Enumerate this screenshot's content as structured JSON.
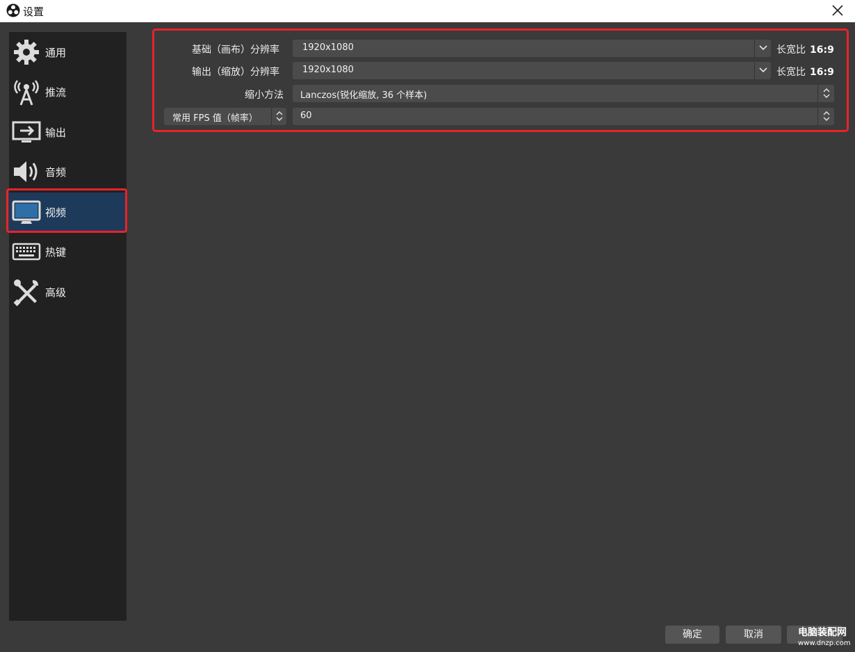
{
  "window": {
    "title": "设置"
  },
  "sidebar": {
    "items": [
      {
        "label": "通用",
        "icon": "gear-icon"
      },
      {
        "label": "推流",
        "icon": "antenna-icon"
      },
      {
        "label": "输出",
        "icon": "output-monitor-icon"
      },
      {
        "label": "音频",
        "icon": "speaker-icon"
      },
      {
        "label": "视频",
        "icon": "monitor-icon",
        "selected": true
      },
      {
        "label": "热键",
        "icon": "keyboard-icon"
      },
      {
        "label": "高级",
        "icon": "tools-icon"
      }
    ]
  },
  "video": {
    "base_resolution": {
      "label": "基础（画布）分辨率",
      "value": "1920x1080",
      "aspect_label": "长宽比",
      "aspect_value": "16:9"
    },
    "output_resolution": {
      "label": "输出（缩放）分辨率",
      "value": "1920x1080",
      "aspect_label": "长宽比",
      "aspect_value": "16:9"
    },
    "downscale_filter": {
      "label": "缩小方法",
      "value": "Lanczos(锐化缩放, 36 个样本)"
    },
    "fps": {
      "type_label": "常用 FPS 值（帧率）",
      "value": "60"
    }
  },
  "buttons": {
    "ok": "确定",
    "cancel": "取消"
  },
  "watermark": {
    "line1": "电脑装配网",
    "line2": "www.dnzp.com"
  },
  "colors": {
    "highlight": "#e8232a",
    "selected_bg": "#1e3a5a",
    "bg": "#3a3a3a",
    "sidebar_bg": "#212121"
  }
}
